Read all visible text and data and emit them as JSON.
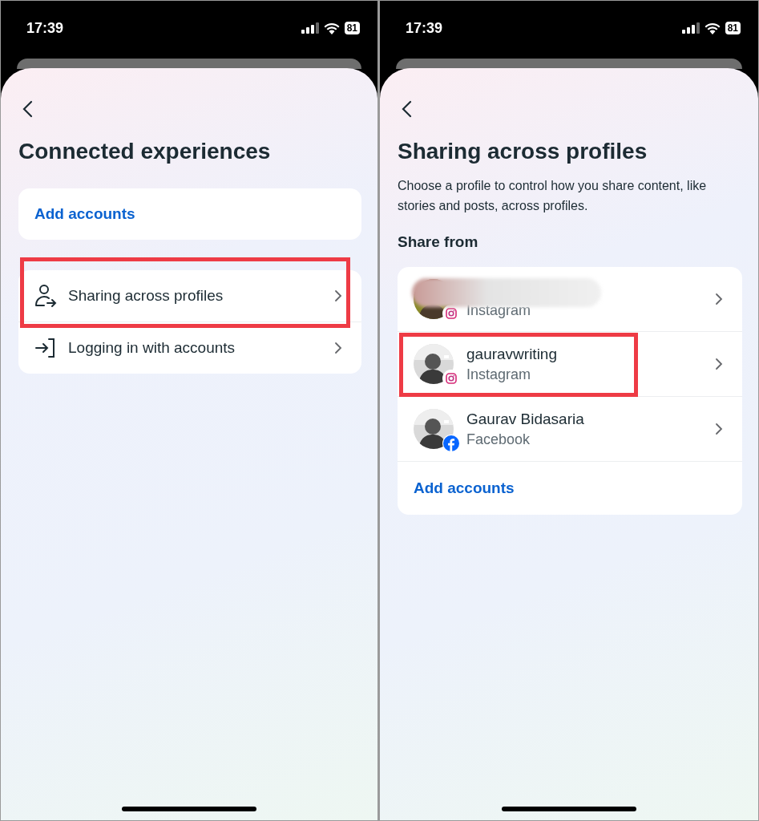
{
  "screens": [
    {
      "kind": "connected",
      "status_bar": {
        "time": "17:39",
        "battery": "81"
      },
      "title": "Connected experiences",
      "top_link": "Add accounts",
      "menu": [
        {
          "label": "Sharing across profiles",
          "kind": "share",
          "highlighted": true
        },
        {
          "label": "Logging in with accounts",
          "kind": "login",
          "highlighted": false
        }
      ]
    },
    {
      "kind": "sharing",
      "status_bar": {
        "time": "17:39",
        "battery": "81"
      },
      "title": "Sharing across profiles",
      "description": "Choose a profile to control how you share content, like stories and posts, across profiles.",
      "section": "Share from",
      "profiles": [
        {
          "redacted": true,
          "platform": "Instagram",
          "kind": "instagram",
          "highlighted": false
        },
        {
          "name": "gauravwriting",
          "redacted": false,
          "platform": "Instagram",
          "kind": "instagram",
          "highlighted": true
        },
        {
          "name": "Gaurav Bidasaria",
          "redacted": false,
          "platform": "Facebook",
          "kind": "facebook",
          "highlighted": false
        }
      ],
      "bottom_link": "Add accounts"
    }
  ]
}
